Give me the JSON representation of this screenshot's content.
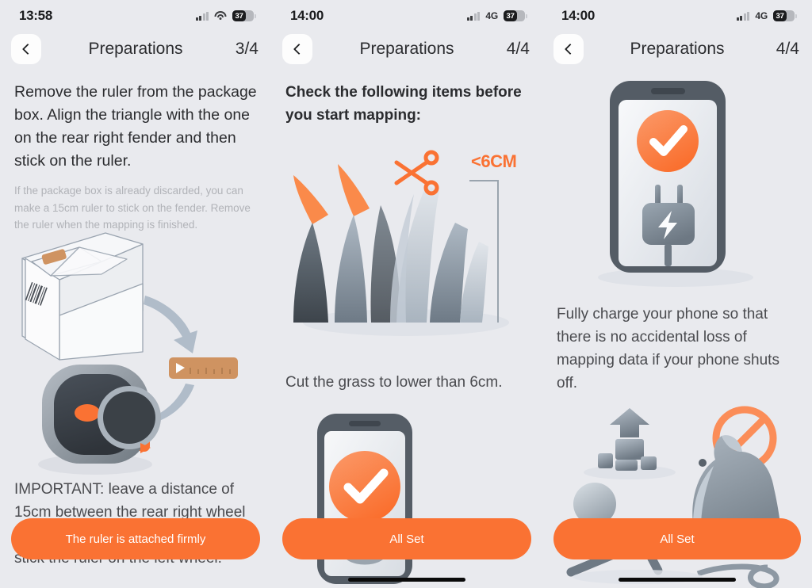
{
  "theme": {
    "background": "#e9eaee",
    "accent_orange": "#fa7233",
    "text_dark": "#2b2c2f",
    "text_muted": "#b1b3b8",
    "gray_illustration": "#8c98a4",
    "ruler_tan": "#cf9361"
  },
  "panels": [
    {
      "status": {
        "time": "13:58",
        "network": "",
        "battery_level": "37",
        "signal_icon": "cellular-signal-icon",
        "connection_icon": "wifi-icon",
        "battery_icon": "battery-icon"
      },
      "nav": {
        "back_icon": "chevron-left-icon",
        "title": "Preparations",
        "counter": "3/4"
      },
      "headline": "Remove the ruler from the package box. Align the triangle with the one on the rear right fender and then stick on the ruler.",
      "subtext": "If the package box is already discarded, you can make a 15cm ruler to stick on the fender. Remove the ruler when the mapping is finished.",
      "lower_text": "IMPORTANT: leave a distance of 15cm between the rear right wheel prevent it from being stuck. Do not stick the ruler on the left wheel.",
      "illustration": "package-box-and-mower-with-ruler",
      "cta_label": "The ruler is attached firmly"
    },
    {
      "status": {
        "time": "14:00",
        "network": "4G",
        "battery_level": "37",
        "signal_icon": "cellular-signal-icon",
        "connection_icon": "network-type-label",
        "battery_icon": "battery-icon"
      },
      "nav": {
        "back_icon": "chevron-left-icon",
        "title": "Preparations",
        "counter": "4/4"
      },
      "headline": "Check the following items before you start mapping:",
      "grass_badge": "<6CM",
      "caption": "Cut the grass to lower than 6cm.",
      "illustration": "grass-with-scissors-and-height-marker",
      "illustration_secondary": "phone-with-checkmark",
      "cta_label": "All Set"
    },
    {
      "status": {
        "time": "14:00",
        "network": "4G",
        "battery_level": "37",
        "signal_icon": "cellular-signal-icon",
        "connection_icon": "network-type-label",
        "battery_icon": "battery-icon"
      },
      "nav": {
        "back_icon": "chevron-left-icon",
        "title": "Preparations",
        "counter": "4/4"
      },
      "headline": "Fully charge your phone so that there is no accidental loss of mapping data if your phone shuts off.",
      "illustration": "phone-charging-with-checkmark",
      "illustration_secondary": "dog-toys-and-obstacles-prohibited",
      "cta_label": "All Set"
    }
  ]
}
